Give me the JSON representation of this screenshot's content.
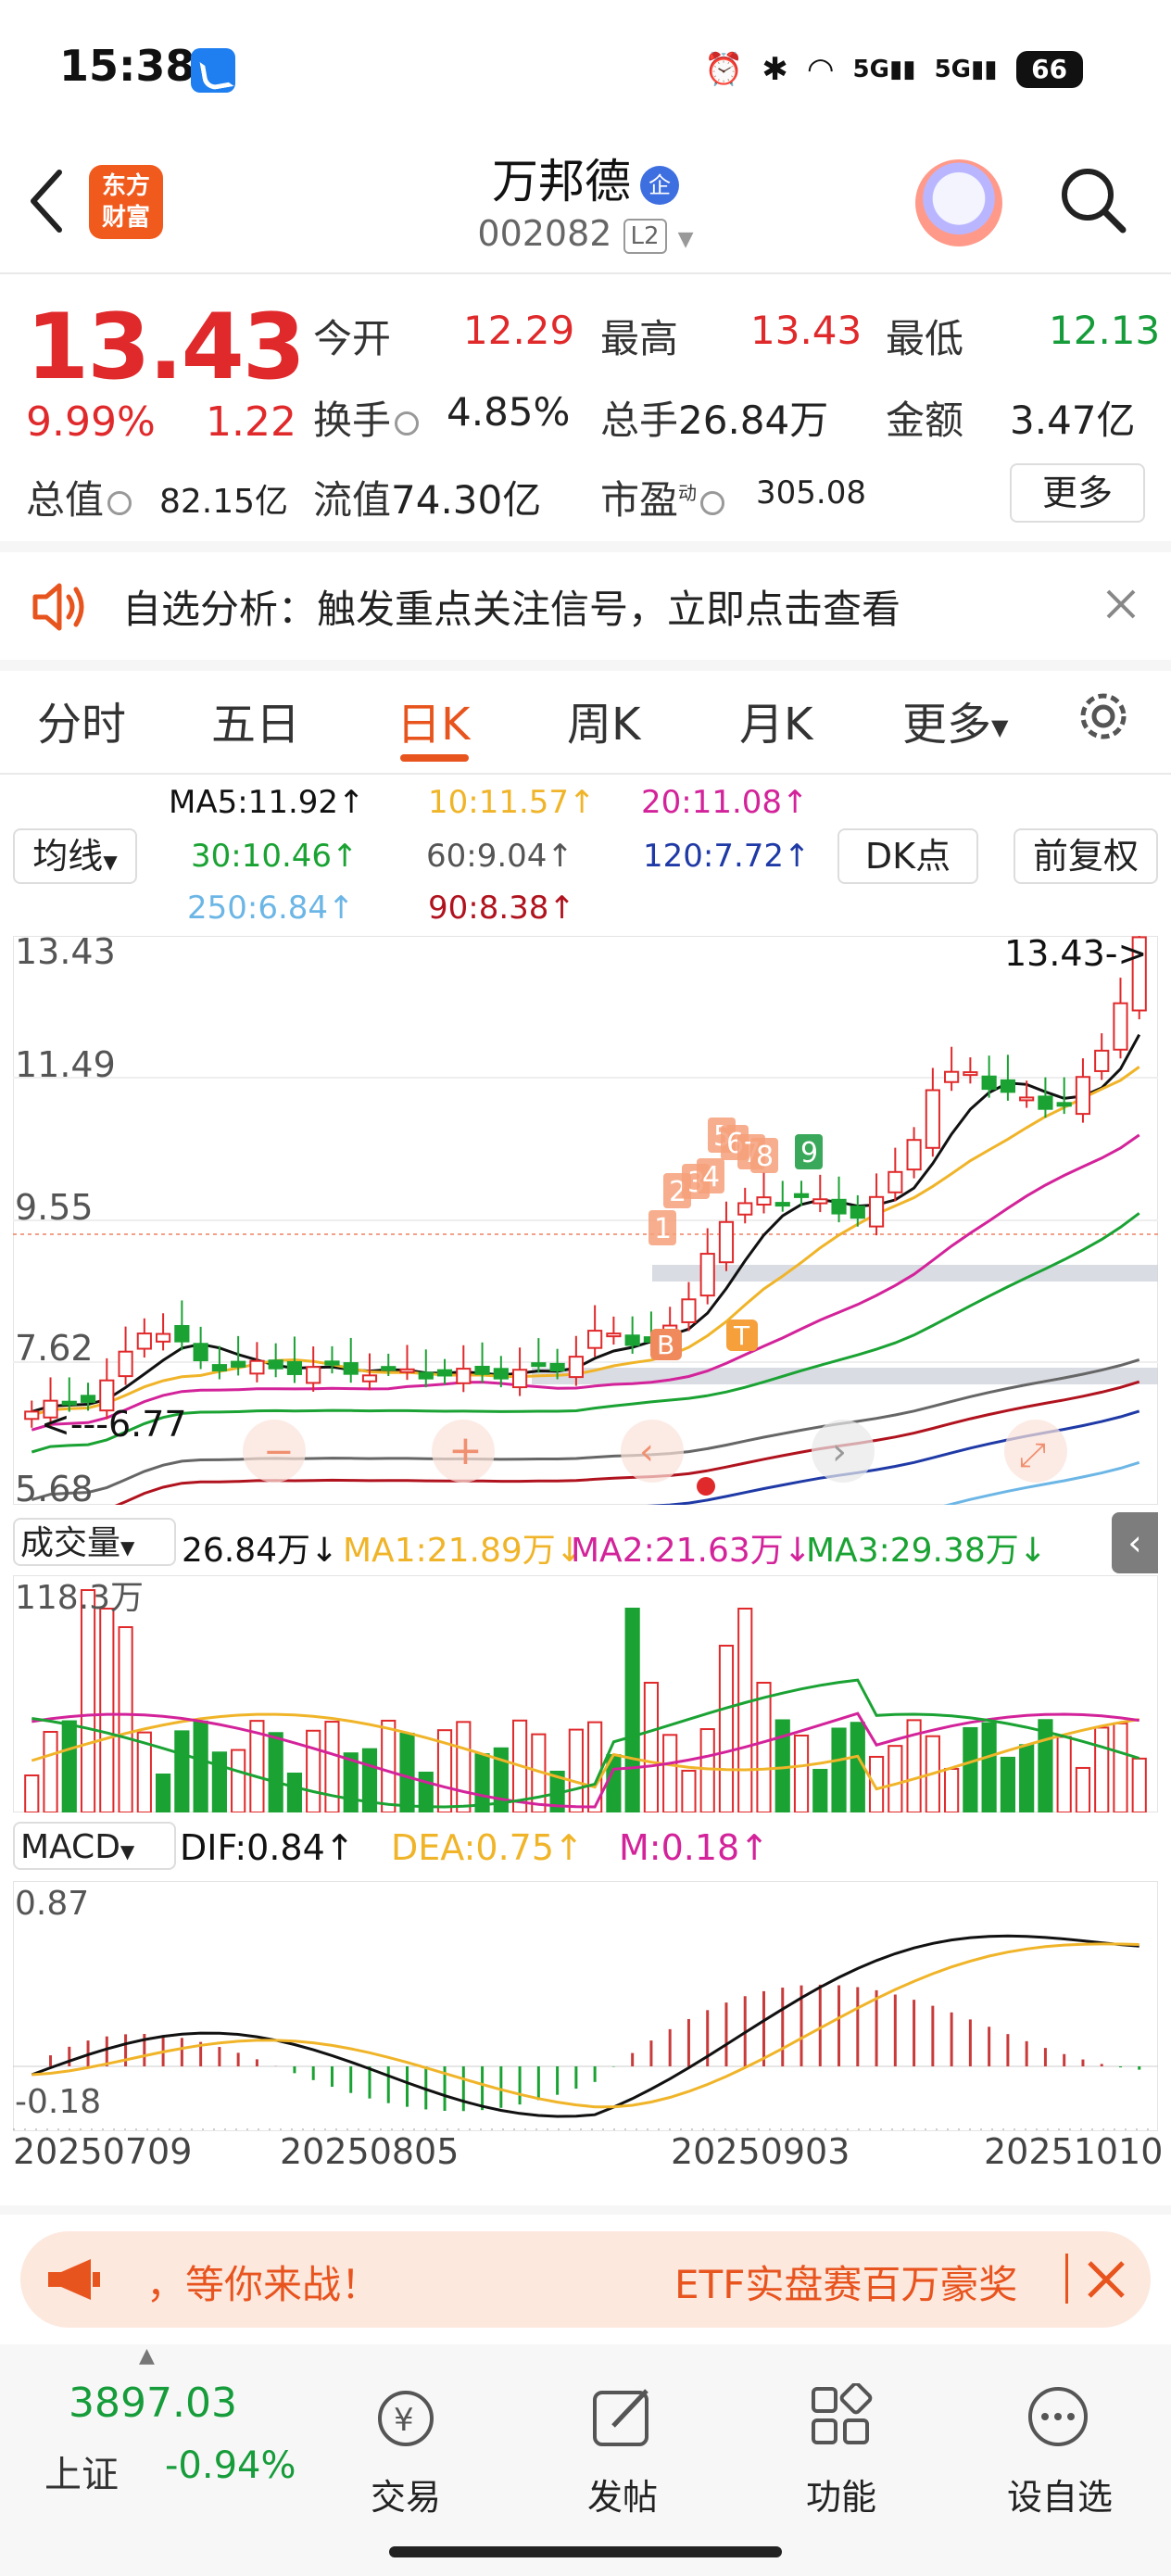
{
  "status_bar": {
    "time": "15:38",
    "battery": "66"
  },
  "header": {
    "title": "万邦德",
    "title_badge": "企",
    "code": "002082",
    "level": "L2",
    "logo_line1": "东方",
    "logo_line2": "财富"
  },
  "quote": {
    "price": "13.43",
    "change_pct": "9.99%",
    "change": "1.22",
    "open_label": "今开",
    "open": "12.29",
    "high_label": "最高",
    "high": "13.43",
    "low_label": "最低",
    "low": "12.13",
    "turnover_label": "换手",
    "turnover": "4.85%",
    "volume_label": "总手",
    "volume": "26.84万",
    "amount_label": "金额",
    "amount": "3.47亿",
    "mktcap_label": "总值",
    "mktcap": "82.15亿",
    "float_label": "流值",
    "float_cap": "74.30亿",
    "pe_label": "市盈",
    "pe_sup": "动",
    "pe": "305.08",
    "more_button": "更多"
  },
  "notice": {
    "text": "自选分析：触发重点关注信号，立即点击查看"
  },
  "tabs": [
    "分时",
    "五日",
    "日K",
    "周K",
    "月K",
    "更多"
  ],
  "active_tab": "日K",
  "ma_panel": {
    "dropdown": "均线",
    "ma5": "MA5:11.92↑",
    "ma10": "10:11.57↑",
    "ma20": "20:11.08↑",
    "ma30": "30:10.46↑",
    "ma60": "60:9.04↑",
    "ma120": "120:7.72↑",
    "ma250": "250:6.84↑",
    "ma90": "90:8.38↑",
    "dk_button": "DK点",
    "adjust_button": "前复权"
  },
  "kline": {
    "price_top": "13.43",
    "price_2": "11.49",
    "price_3": "9.55",
    "price_4": "7.62",
    "price_bottom": "5.68",
    "high_marker": "13.43->",
    "low_marker": "<---6.77",
    "signals": [
      "1",
      "2",
      "3",
      "4",
      "5",
      "6",
      "7",
      "8",
      "9"
    ],
    "buy_marker": "B",
    "sell_marker": "T",
    "colors": {
      "up": "#e0292b",
      "down": "#1aa233",
      "ma5": "#111111",
      "ma10": "#f0b429",
      "ma20": "#d3239a",
      "ma30": "#1aa233",
      "ma60": "#666666",
      "ma90": "#b0131e",
      "ma120": "#1f3aa6",
      "ma250": "#6cb6e6"
    }
  },
  "volume": {
    "dropdown": "成交量",
    "value": "26.84万↓",
    "ma1": "MA1:21.89万↓",
    "ma2": "MA2:21.63万↓",
    "ma3": "MA3:29.38万↓",
    "axis_top": "118.3万"
  },
  "macd": {
    "dropdown": "MACD",
    "dif": "DIF:0.84↑",
    "dea": "DEA:0.75↑",
    "m": "M:0.18↑",
    "axis_top": "0.87",
    "axis_bottom": "-0.18"
  },
  "dates": [
    "20250709",
    "20250805",
    "20250903",
    "20251010"
  ],
  "banner": {
    "left_text": "，等你来战！",
    "right_text": "ETF实盘赛百万豪奖"
  },
  "bottom_nav": {
    "index_value": "3897.03",
    "index_name": "上证",
    "index_change": "-0.94%",
    "items": [
      "交易",
      "发帖",
      "功能",
      "设自选"
    ]
  }
}
